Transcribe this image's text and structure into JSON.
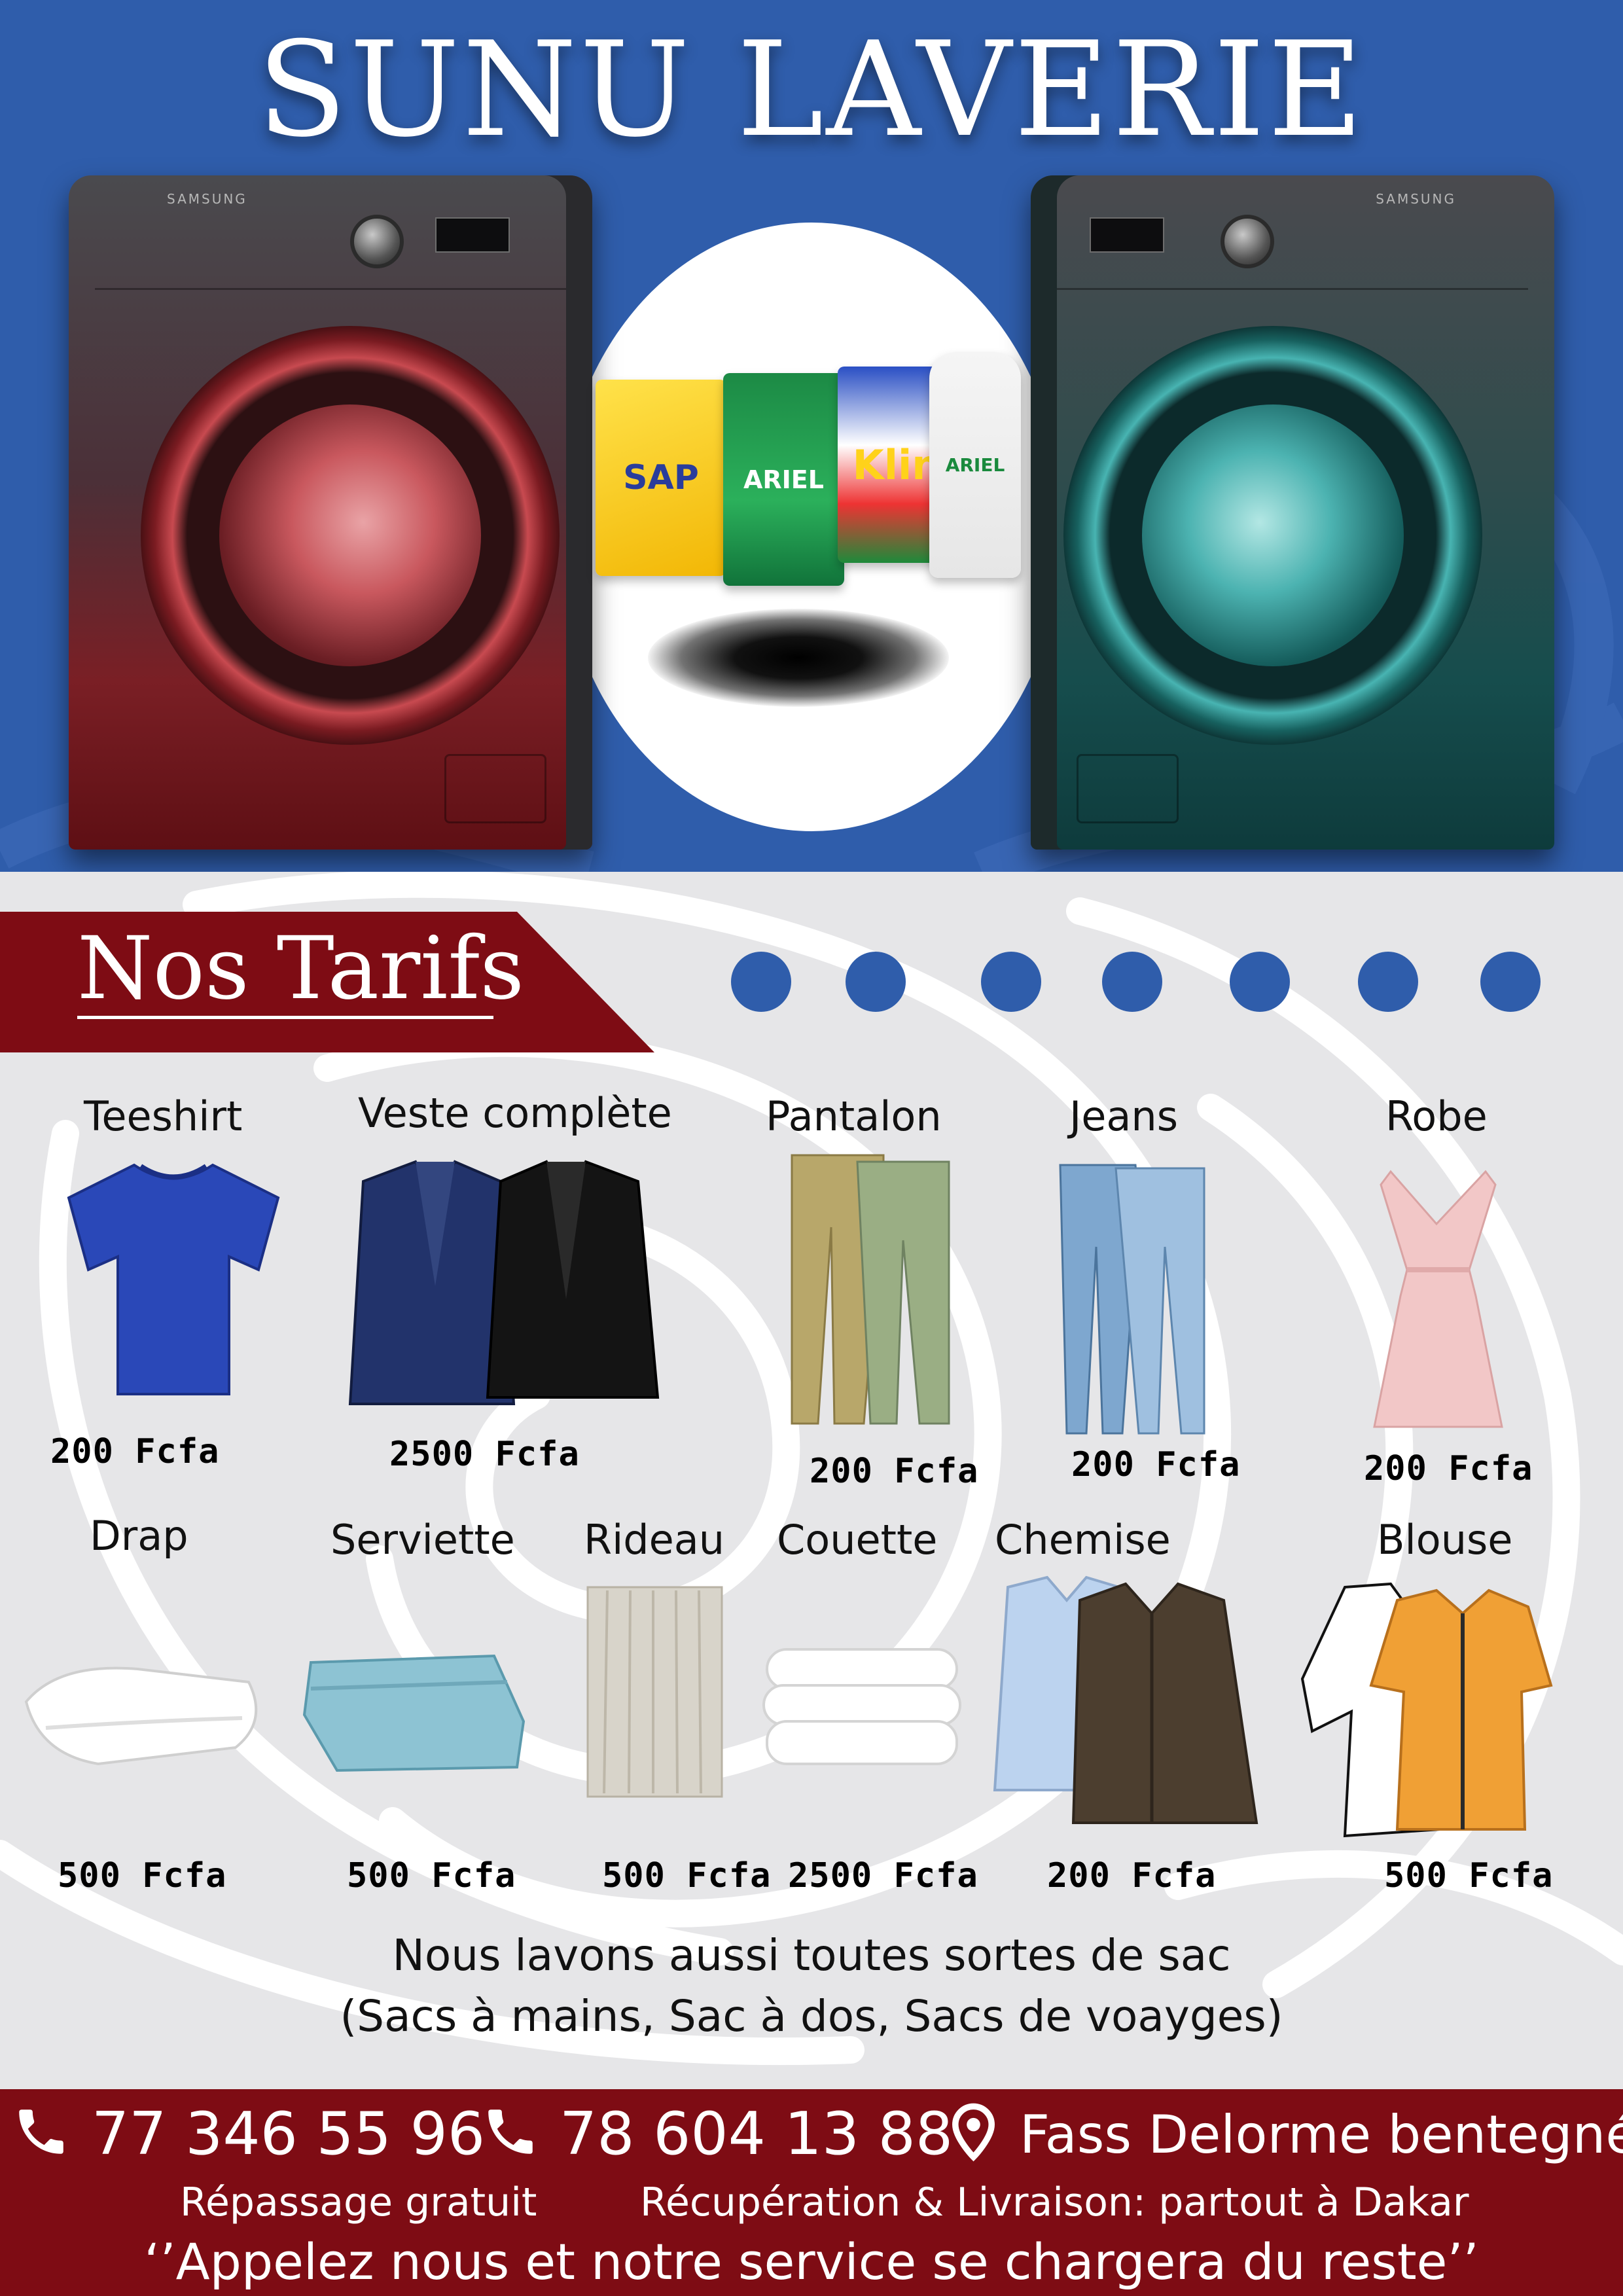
{
  "header": {
    "title": "SUNU LAVERIE"
  },
  "machines": {
    "brand": "SAMSUNG"
  },
  "detergents": [
    "SAP",
    "ARIEL",
    "Klin",
    "ARIEL"
  ],
  "tarifs": {
    "title": "Nos Tarifs",
    "row1": [
      {
        "label": "Teeshirt",
        "price": "200 Fcfa"
      },
      {
        "label": "Veste complète",
        "price": "2500 Fcfa"
      },
      {
        "label": "Pantalon",
        "price": "200 Fcfa"
      },
      {
        "label": "Jeans",
        "price": "200 Fcfa"
      },
      {
        "label": "Robe",
        "price": "200 Fcfa"
      }
    ],
    "row2": [
      {
        "label": "Drap",
        "price": "500 Fcfa"
      },
      {
        "label": "Serviette",
        "price": "500 Fcfa"
      },
      {
        "label": "Rideau",
        "price": "500 Fcfa"
      },
      {
        "label": "Couette",
        "price": "2500 Fcfa"
      },
      {
        "label": "Chemise",
        "price": "200 Fcfa"
      },
      {
        "label": "Blouse",
        "price": "500 Fcfa"
      }
    ]
  },
  "bags": {
    "line1": "Nous lavons aussi toutes sortes de sac",
    "line2": "(Sacs à mains, Sac à dos, Sacs de voayges)"
  },
  "footer": {
    "phone1": "77 346 55 96",
    "phone2": "78 604 13 88",
    "address": "Fass Delorme bentegné",
    "ironing": "Répassage gratuit",
    "delivery": "Récupération & Livraison: partout à Dakar",
    "slogan": "‘’Appelez nous et notre service se chargera du reste’’"
  },
  "colors": {
    "brand_blue": "#2f5dab",
    "brand_red": "#7e0c14",
    "background": "#e6e6e8"
  }
}
